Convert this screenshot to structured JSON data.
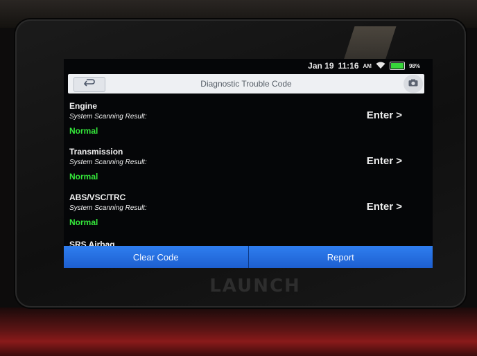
{
  "status_bar": {
    "date": "Jan 19",
    "time": "11:16",
    "ampm": "AM",
    "battery": "98%"
  },
  "header": {
    "title": "Diagnostic Trouble Code"
  },
  "systems": [
    {
      "name": "Engine",
      "scan_label": "System Scanning Result:",
      "status": "Normal",
      "action": "Enter >"
    },
    {
      "name": "Transmission",
      "scan_label": "System Scanning Result:",
      "status": "Normal",
      "action": "Enter >"
    },
    {
      "name": "ABS/VSC/TRC",
      "scan_label": "System Scanning Result:",
      "status": "Normal",
      "action": "Enter >"
    },
    {
      "name": "SRS Airbag"
    }
  ],
  "footer": {
    "clear_label": "Clear Code",
    "report_label": "Report"
  },
  "device": {
    "brand": "LAUNCH"
  },
  "colors": {
    "accent": "#2f7ef0",
    "normal": "#35e83b"
  }
}
